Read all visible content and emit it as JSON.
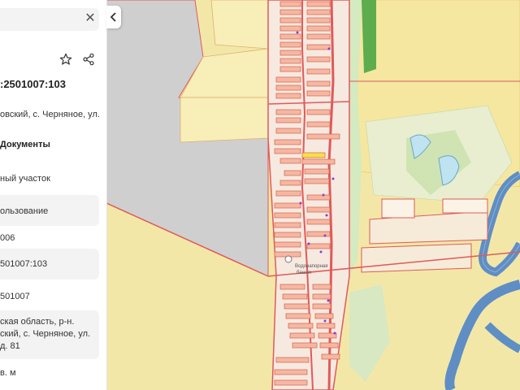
{
  "panel": {
    "cadastral_number": ":2501007:103",
    "address_short": "овский, с. Черняное, ул.",
    "documents_label": "Документы",
    "rows": [
      {
        "value": "ный участок"
      },
      {
        "value": "ользование"
      },
      {
        "value": "006"
      },
      {
        "value": "501007:103"
      },
      {
        "value": "501007"
      }
    ],
    "address_full": [
      "ская область, р-н.",
      "ский, с. Черняное, ул.",
      "д. 81"
    ],
    "area_unit": "в. м"
  },
  "map": {
    "poi_label": [
      "Водонапорная",
      "башня"
    ]
  },
  "colors": {
    "base": "#f3e7a8",
    "gray_area": "#cfcfcf",
    "parcel_fill": "#f6e9e0",
    "parcel_border": "#e05a5a",
    "green": "#d4eac0",
    "water": "#5f8ec4"
  },
  "icons": [
    "close-icon",
    "star-icon",
    "share-icon",
    "chevron-left-icon"
  ]
}
